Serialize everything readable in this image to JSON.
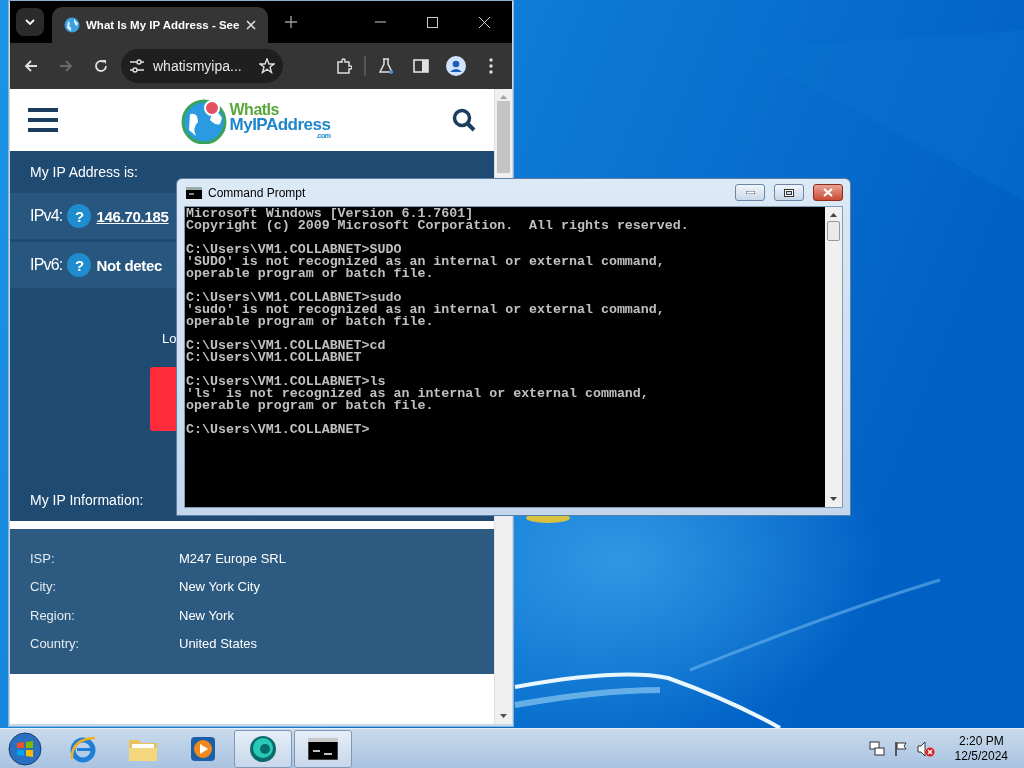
{
  "browser": {
    "tabs": [
      {
        "title": "What Is My IP Address - See",
        "selected": true
      }
    ],
    "navigation": {
      "forward_disabled": true
    },
    "address": "whatismyipa...",
    "page": {
      "logo": {
        "line1": "WhatIs",
        "line2": "MyIPAddress",
        "suffix": ".com"
      },
      "ip_heading": "My IP Address is:",
      "ip_rows": [
        {
          "label": "IPv4:",
          "help": "?",
          "value": "146.70.185",
          "link": true
        },
        {
          "label": "IPv6:",
          "help": "?",
          "value": "Not detec",
          "link": false
        }
      ],
      "lookup_text": "Lo",
      "info_heading": "My IP Information:",
      "info_rows": [
        {
          "label": "ISP:",
          "value": "M247 Europe SRL"
        },
        {
          "label": "City:",
          "value": "New York City"
        },
        {
          "label": "Region:",
          "value": "New York"
        },
        {
          "label": "Country:",
          "value": "United States"
        }
      ]
    }
  },
  "console": {
    "title": "Command Prompt",
    "blocks": [
      [
        "Microsoft Windows [Version 6.1.7601]",
        "Copyright (c) 2009 Microsoft Corporation.  All rights reserved."
      ],
      [
        "C:\\Users\\VM1.COLLABNET>SUDO",
        "'SUDO' is not recognized as an internal or external command,",
        "operable program or batch file."
      ],
      [
        "C:\\Users\\VM1.COLLABNET>sudo",
        "'sudo' is not recognized as an internal or external command,",
        "operable program or batch file."
      ],
      [
        "C:\\Users\\VM1.COLLABNET>cd",
        "C:\\Users\\VM1.COLLABNET"
      ],
      [
        "C:\\Users\\VM1.COLLABNET>ls",
        "'ls' is not recognized as an internal or external command,",
        "operable program or batch file."
      ],
      [
        "C:\\Users\\VM1.COLLABNET>"
      ]
    ]
  },
  "taskbar": {
    "items": [
      {
        "kind": "ie",
        "running": false
      },
      {
        "kind": "folder",
        "running": false
      },
      {
        "kind": "media",
        "running": false
      },
      {
        "kind": "chrome",
        "running": true
      },
      {
        "kind": "console",
        "running": true
      }
    ],
    "volume_muted": true,
    "clock": {
      "time": "2:20 PM",
      "date": "12/5/2024"
    }
  }
}
